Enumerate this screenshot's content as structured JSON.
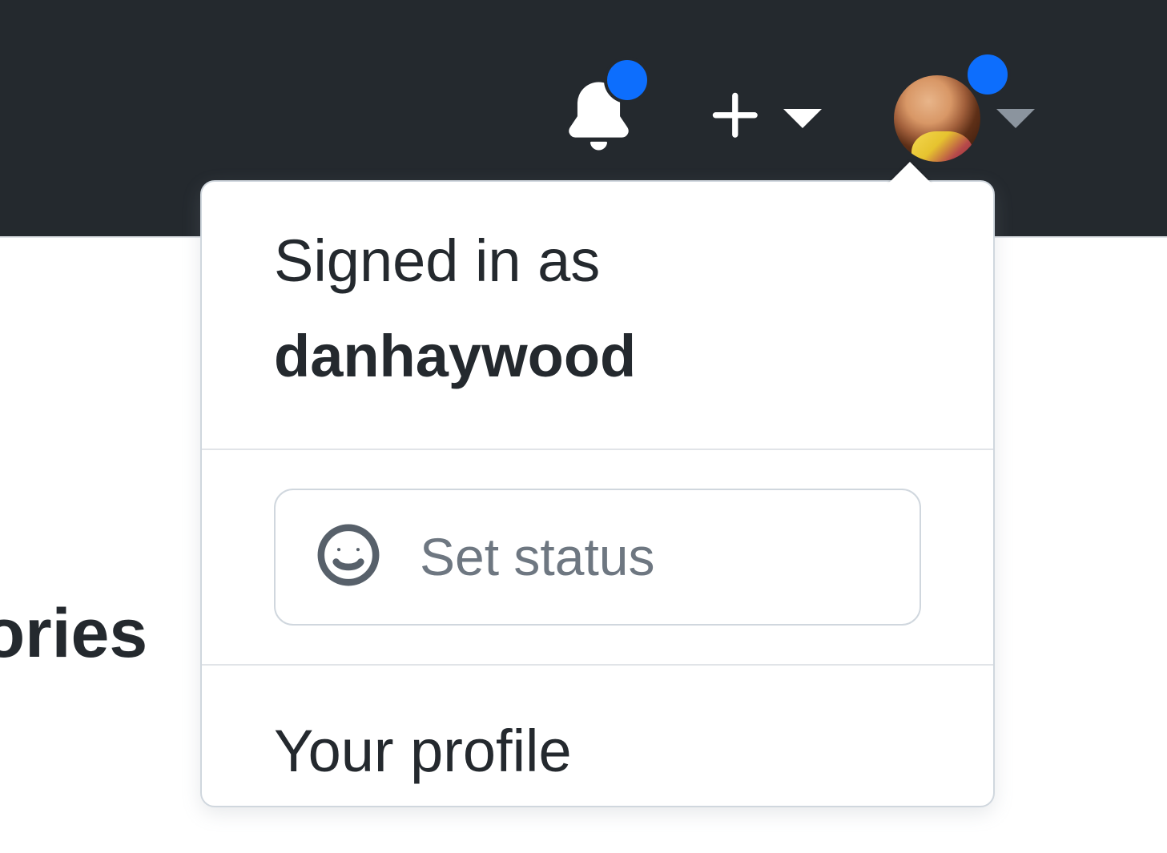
{
  "header": {
    "notifications_has_unread": true,
    "avatar_has_indicator": true
  },
  "background": {
    "partial_text": "tories"
  },
  "dropdown": {
    "signed_in_label": "Signed in as",
    "username": "danhaywood",
    "set_status_label": "Set status",
    "menu_items": [
      "Your profile"
    ]
  },
  "colors": {
    "header_bg": "#24292e",
    "indicator_blue": "#0d6efd",
    "text_primary": "#24292e",
    "text_muted": "#6e7781",
    "border": "#d0d7de"
  }
}
